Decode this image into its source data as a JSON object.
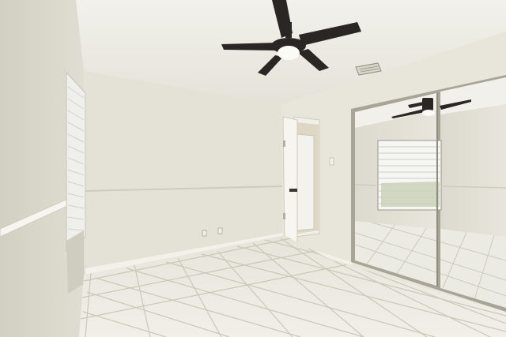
{
  "scene": {
    "subject": "empty-bedroom-interior",
    "elements": [
      "ceiling-fan",
      "window-blinds",
      "interior-door",
      "mirrored-closet-doors",
      "tile-floor",
      "chair-rail",
      "air-vent",
      "outlet"
    ]
  },
  "colors": {
    "ceiling": "#eeede6",
    "wall_back": "#e6e4d8",
    "wall_left": "#dcdacb",
    "wall_right": "#e9e7dc",
    "floor": "#eae8df",
    "grout": "#c9c5b8",
    "fan": "#2a2624",
    "fan_light": "#fbfbf6",
    "mirror_frame": "#a8a497",
    "blinds": "#f4f4f1"
  }
}
